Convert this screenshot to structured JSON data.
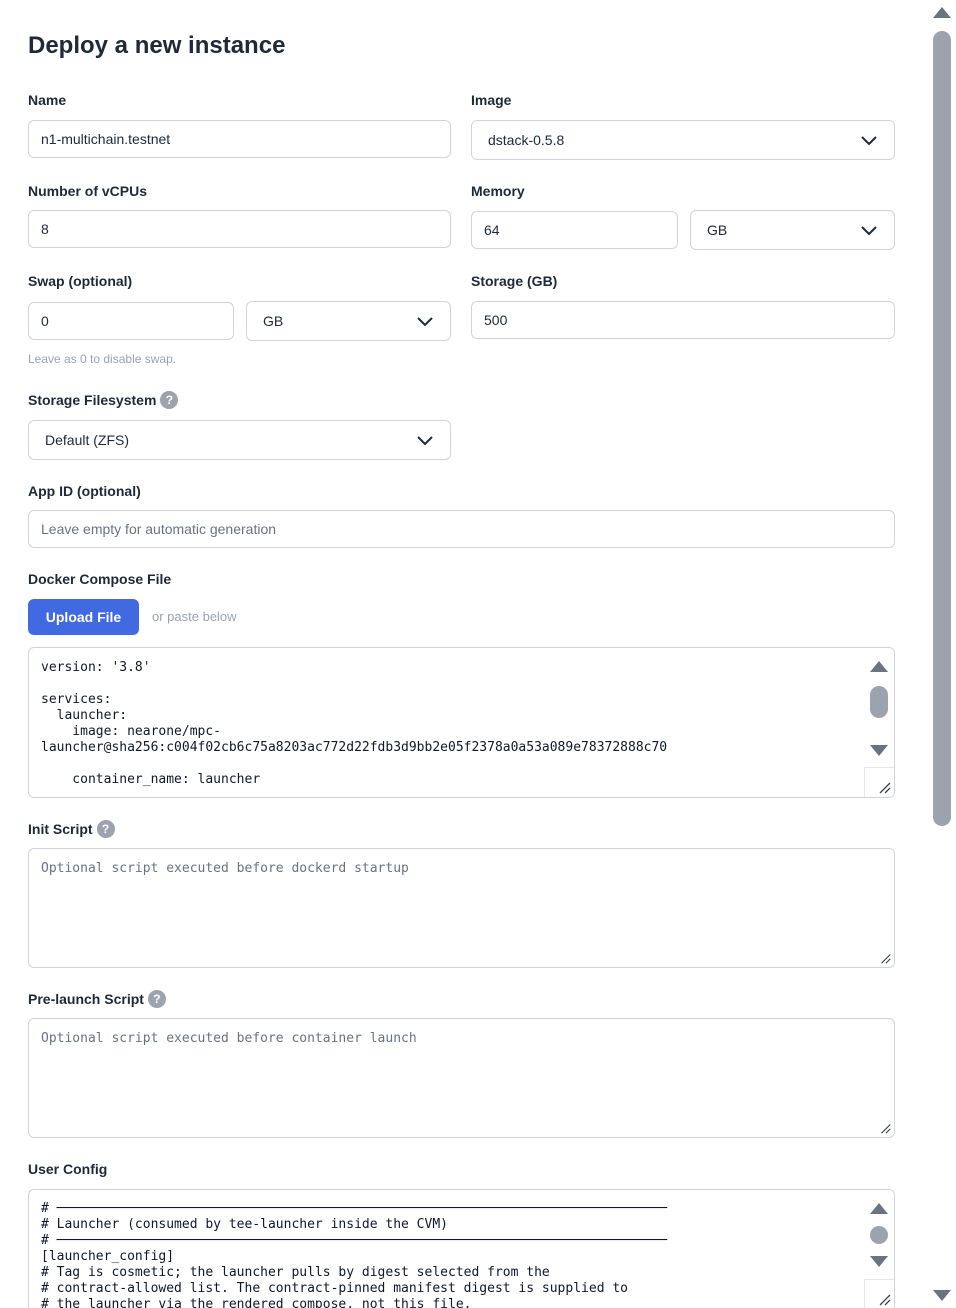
{
  "page": {
    "title": "Deploy a new instance"
  },
  "form": {
    "name": {
      "label": "Name",
      "value": "n1-multichain.testnet"
    },
    "image": {
      "label": "Image",
      "value": "dstack-0.5.8"
    },
    "vcpus": {
      "label": "Number of vCPUs",
      "value": "8"
    },
    "memory": {
      "label": "Memory",
      "value": "64",
      "unit": "GB"
    },
    "swap": {
      "label": "Swap (optional)",
      "value": "0",
      "unit": "GB",
      "hint": "Leave as 0 to disable swap."
    },
    "storage": {
      "label": "Storage (GB)",
      "value": "500"
    },
    "filesystem": {
      "label": "Storage Filesystem",
      "value": "Default (ZFS)",
      "help": "?"
    },
    "app_id": {
      "label": "App ID (optional)",
      "placeholder": "Leave empty for automatic generation"
    },
    "compose": {
      "label": "Docker Compose File",
      "upload_label": "Upload File",
      "or_paste": "or paste below",
      "content": "version: '3.8'\n\nservices:\n  launcher:\n    image: nearone/mpc-\nlauncher@sha256:c004f02cb6c75a8203ac772d22fdb3d9bb2e05f2378a0a53a089e78372888c70\n\n    container_name: launcher"
    },
    "init_script": {
      "label": "Init Script",
      "help": "?",
      "placeholder": "Optional script executed before dockerd startup"
    },
    "prelaunch_script": {
      "label": "Pre-launch Script",
      "help": "?",
      "placeholder": "Optional script executed before container launch"
    },
    "user_config": {
      "label": "User Config",
      "content": "# ──────────────────────────────────────────────────────────────────────────────\n# Launcher (consumed by tee-launcher inside the CVM)\n# ──────────────────────────────────────────────────────────────────────────────\n[launcher_config]\n# Tag is cosmetic; the launcher pulls by digest selected from the\n# contract-allowed list. The contract-pinned manifest digest is supplied to\n# the launcher via the rendered compose, not this file."
    }
  },
  "colors": {
    "primary": "#4169e1",
    "border": "#d1d5db",
    "muted": "#9ca3af"
  }
}
